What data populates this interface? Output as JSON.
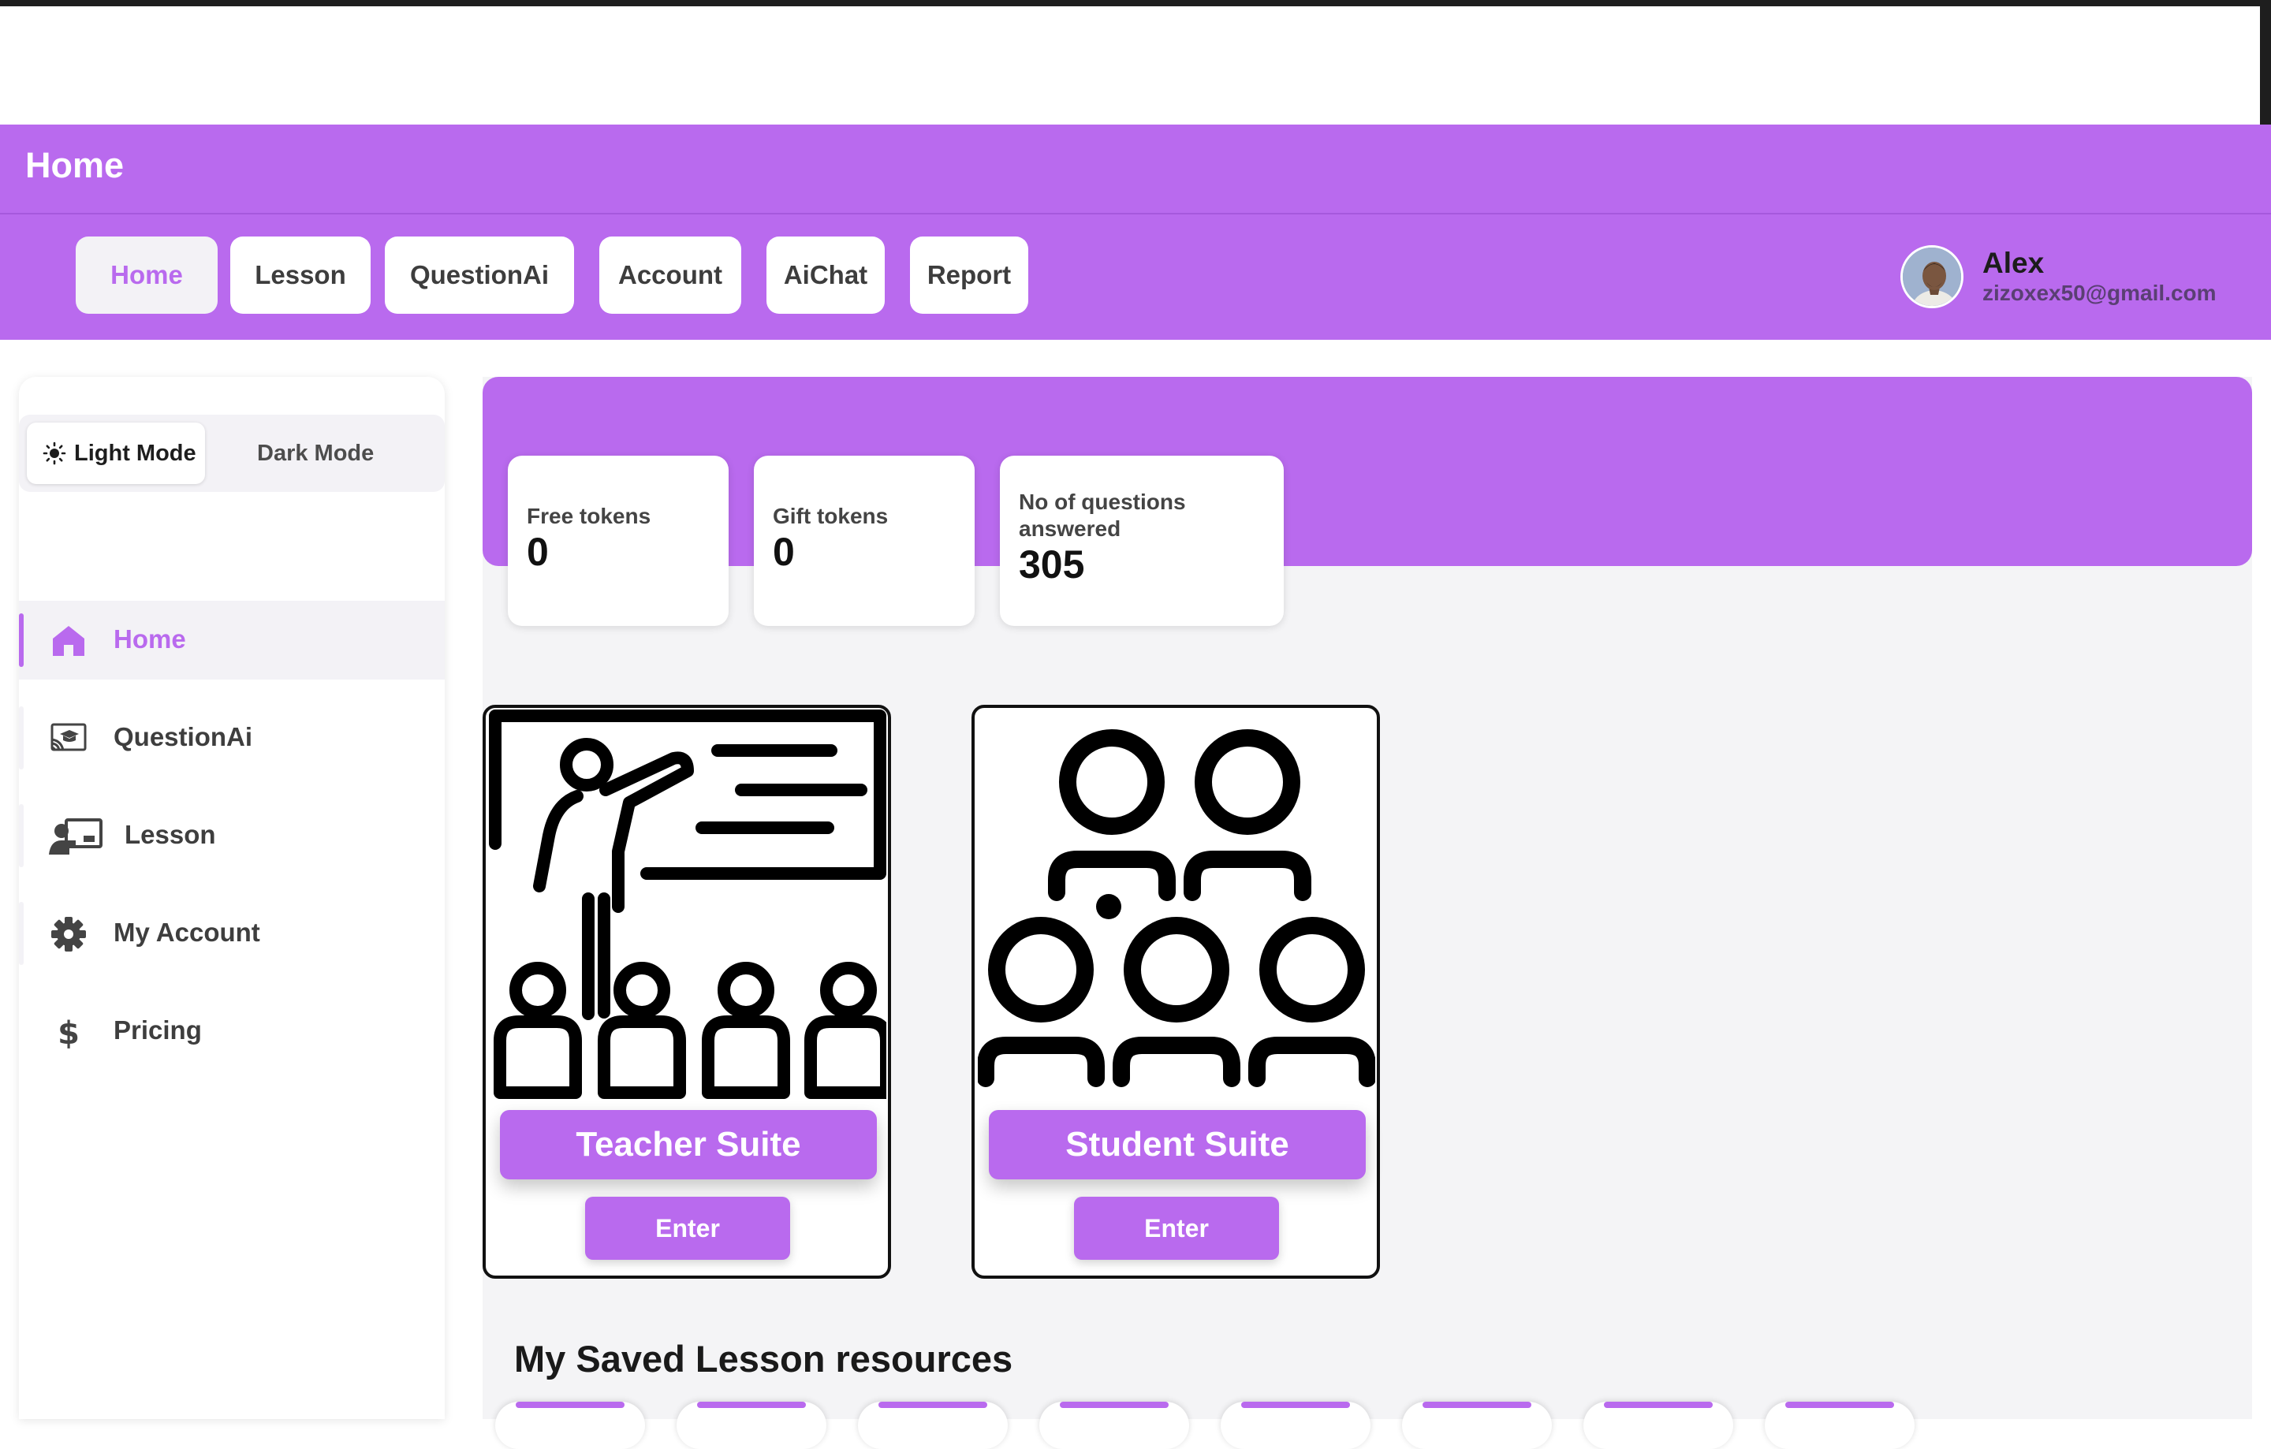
{
  "header": {
    "title": "Home"
  },
  "nav": {
    "items": [
      {
        "label": "Home",
        "active": true
      },
      {
        "label": "Lesson"
      },
      {
        "label": "QuestionAi"
      },
      {
        "label": "Account"
      },
      {
        "label": "AiChat"
      },
      {
        "label": "Report"
      }
    ]
  },
  "user": {
    "name": "Alex",
    "email": "zizoxex50@gmail.com"
  },
  "sidebar": {
    "light_mode": "Light Mode",
    "dark_mode": "Dark Mode",
    "items": [
      {
        "label": "Home",
        "icon": "home-icon",
        "active": true
      },
      {
        "label": "QuestionAi",
        "icon": "classroom-icon"
      },
      {
        "label": "Lesson",
        "icon": "lesson-icon"
      },
      {
        "label": "My Account",
        "icon": "gear-icon"
      },
      {
        "label": "Pricing",
        "icon": "dollar-icon"
      }
    ]
  },
  "stats": [
    {
      "label": "Free tokens",
      "value": "0"
    },
    {
      "label": "Gift tokens",
      "value": "0"
    },
    {
      "label": "No of questions answered",
      "value": "305"
    }
  ],
  "suites": [
    {
      "title": "Teacher Suite",
      "enter": "Enter",
      "icon": "teacher-classroom-icon"
    },
    {
      "title": "Student Suite",
      "enter": "Enter",
      "icon": "students-group-icon"
    }
  ],
  "saved": {
    "title": "My Saved Lesson resources"
  },
  "colors": {
    "accent": "#b96aee",
    "active_bg": "#f3f2f6"
  }
}
